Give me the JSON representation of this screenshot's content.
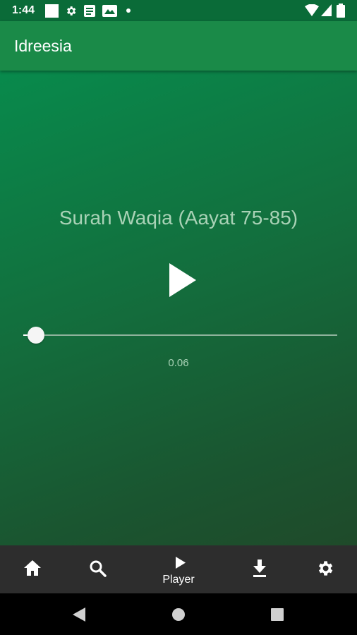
{
  "status_bar": {
    "time": "1:44",
    "icons": [
      "square-icon",
      "gear-icon",
      "document-icon",
      "image-icon",
      "dot-icon",
      "wifi-icon",
      "signal-icon",
      "battery-icon"
    ]
  },
  "app_bar": {
    "title": "Idreesia"
  },
  "player": {
    "track_title": "Surah Waqia (Aayat 75-85)",
    "elapsed": "0.06",
    "progress_fraction": 0.04,
    "state_icon": "play-icon"
  },
  "bottom_nav": {
    "items": [
      {
        "icon": "home-icon",
        "label": ""
      },
      {
        "icon": "search-icon",
        "label": ""
      },
      {
        "icon": "play-icon",
        "label": "Player"
      },
      {
        "icon": "download-icon",
        "label": ""
      },
      {
        "icon": "settings-gear-icon",
        "label": ""
      }
    ],
    "selected": "Player"
  },
  "system_nav": {
    "icons": [
      "back-icon",
      "home-circle-icon",
      "recents-icon"
    ]
  },
  "colors": {
    "status_bar": "#0a6b38",
    "app_bar": "#1a8a48",
    "text_soft": "#a9d2b6",
    "bottom_nav": "#2d2d2d"
  }
}
